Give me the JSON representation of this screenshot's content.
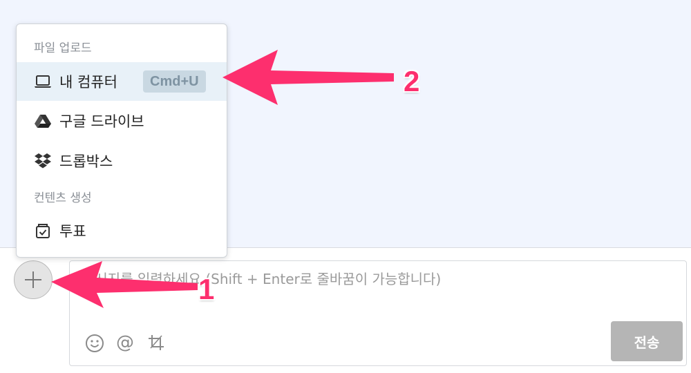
{
  "menu": {
    "upload_section_label": "파일 업로드",
    "items": [
      {
        "label": "내 컴퓨터",
        "icon": "laptop-icon",
        "shortcut": "Cmd+U"
      },
      {
        "label": "구글 드라이브",
        "icon": "google-drive-icon"
      },
      {
        "label": "드롭박스",
        "icon": "dropbox-icon"
      }
    ],
    "content_section_label": "컨텐츠 생성",
    "content_items": [
      {
        "label": "투표",
        "icon": "poll-icon"
      }
    ]
  },
  "composer": {
    "placeholder": "메시지를 입력하세요 (Shift + Enter로 줄바꿈이 가능합니다)",
    "send_label": "전송",
    "tools": [
      "emoji-icon",
      "mention-icon",
      "crop-icon"
    ]
  },
  "annotations": [
    {
      "label": "1",
      "color": "#fd2f6e"
    },
    {
      "label": "2",
      "color": "#fd2f6e"
    }
  ],
  "colors": {
    "chat_background": "#f1f5fe",
    "arrow": "#fd2f6e",
    "active_item": "#e8f1f8",
    "send_button": "#b5b5b5"
  }
}
